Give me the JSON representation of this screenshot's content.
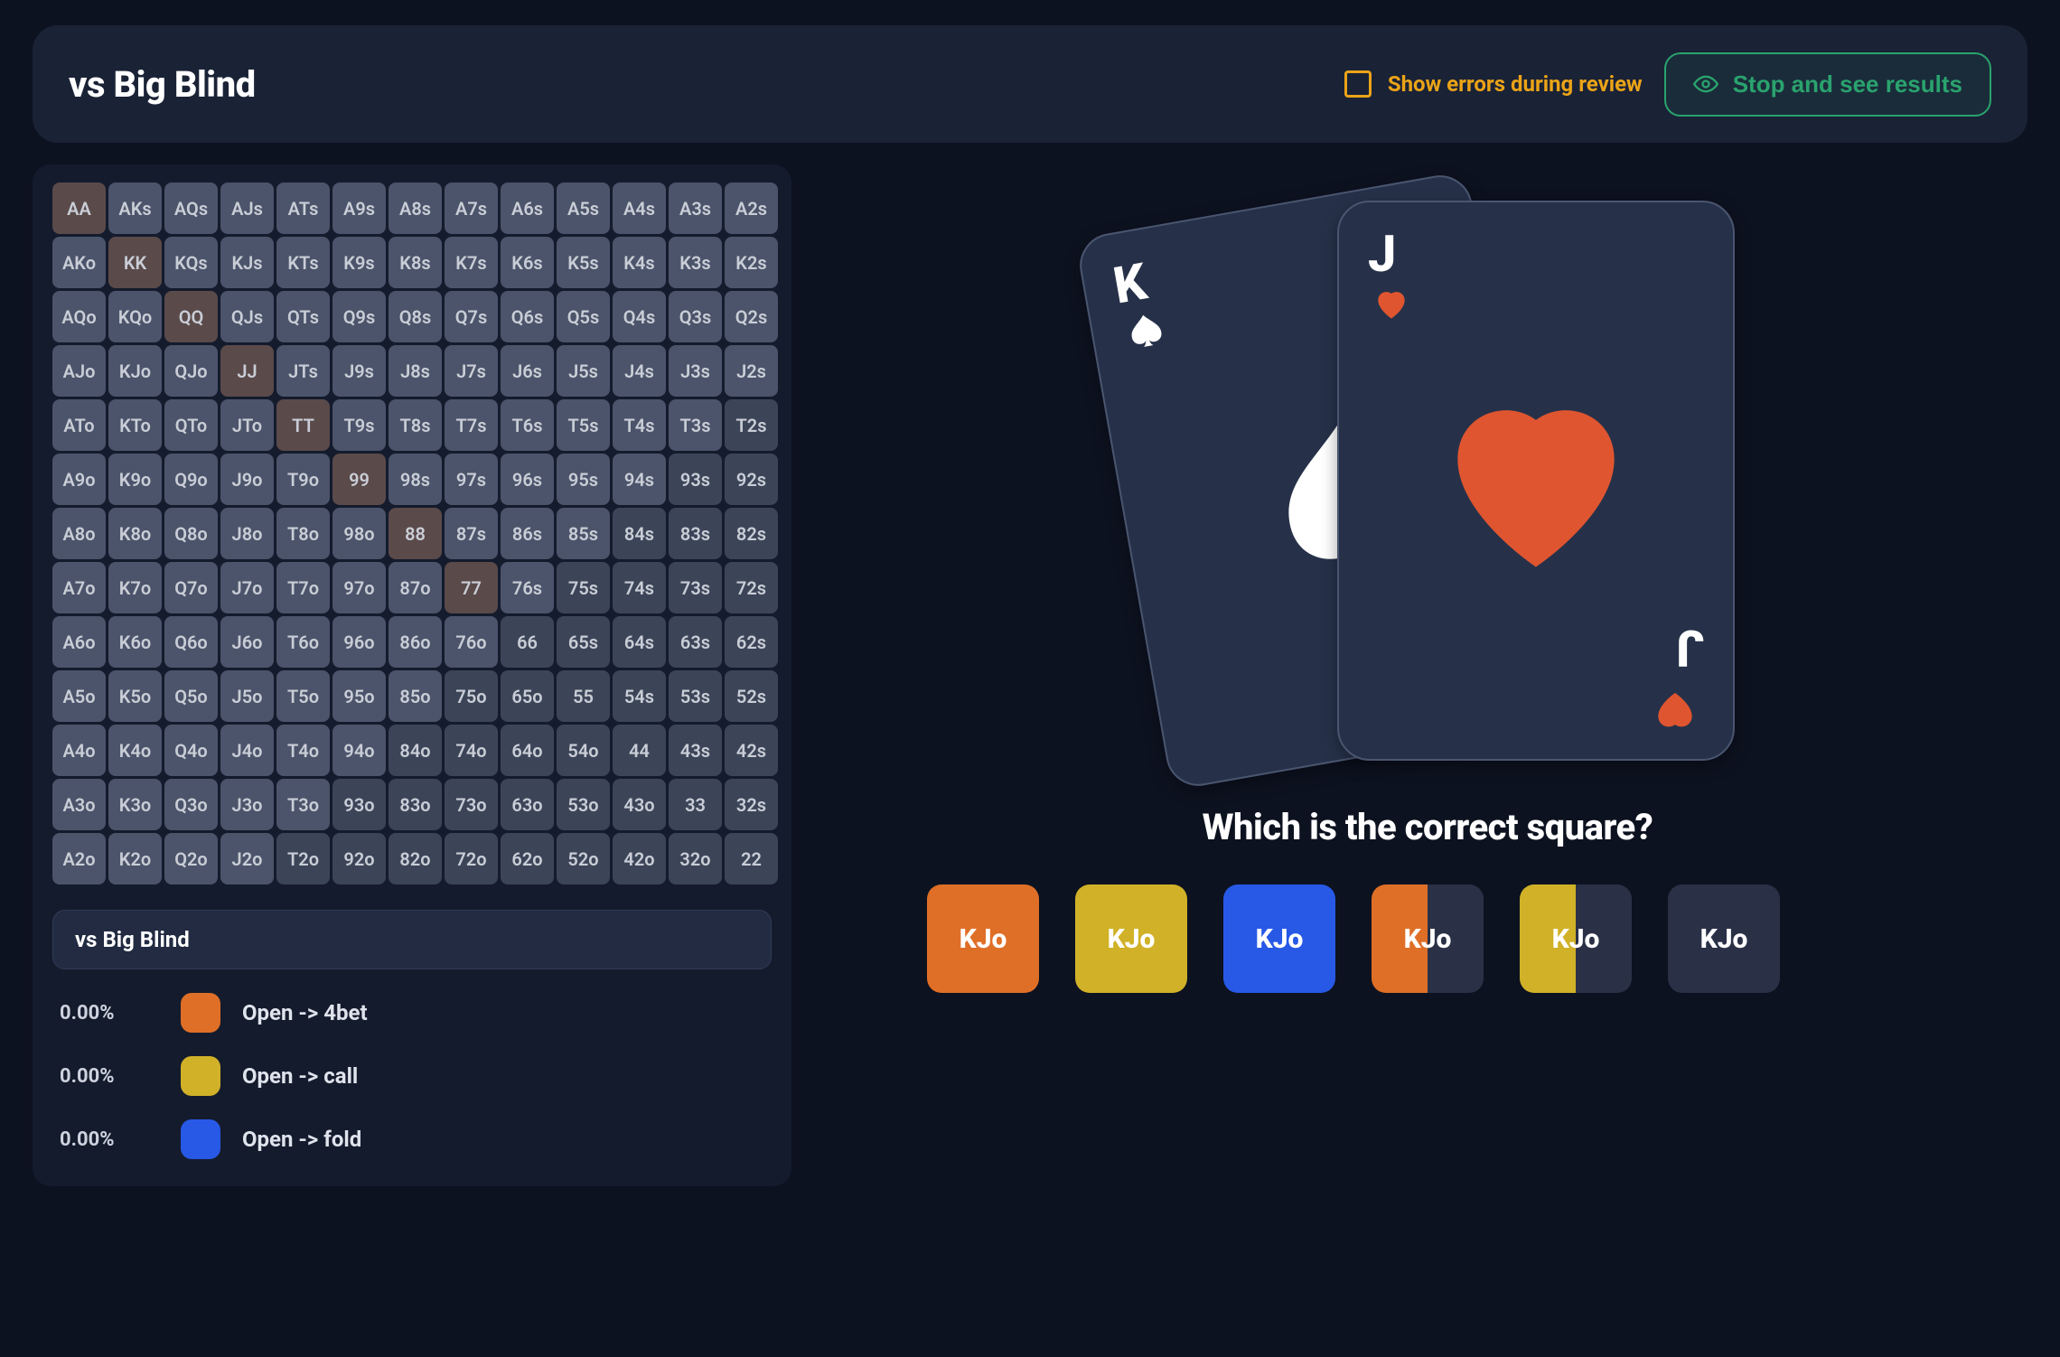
{
  "header": {
    "title": "vs Big Blind",
    "toggle_label": "Show errors during review",
    "results_label": "Stop and see results"
  },
  "range_panel": {
    "title": "vs Big Blind",
    "ranks": [
      "A",
      "K",
      "Q",
      "J",
      "T",
      "9",
      "8",
      "7",
      "6",
      "5",
      "4",
      "3",
      "2"
    ],
    "legend": [
      {
        "pct": "0.00%",
        "color": "orange",
        "label": "Open -> 4bet"
      },
      {
        "pct": "0.00%",
        "color": "yellow",
        "label": "Open -> call"
      },
      {
        "pct": "0.00%",
        "color": "blue",
        "label": "Open -> fold"
      }
    ]
  },
  "question_panel": {
    "cards": [
      {
        "rank": "K",
        "suit": "spade",
        "color": "white"
      },
      {
        "rank": "J",
        "suit": "heart",
        "color": "red"
      }
    ],
    "prompt": "Which is the correct square?",
    "hand_label": "KJo",
    "answers": [
      {
        "label": "KJo",
        "bg": "orange"
      },
      {
        "label": "KJo",
        "bg": "yellow"
      },
      {
        "label": "KJo",
        "bg": "blue"
      },
      {
        "label": "KJo",
        "split": [
          "orange",
          "dark"
        ]
      },
      {
        "label": "KJo",
        "split": [
          "yellow",
          "dark"
        ]
      },
      {
        "label": "KJo",
        "bg": "dark"
      }
    ]
  },
  "colors": {
    "orange": "#df6f27",
    "yellow": "#d0b127",
    "blue": "#2759e6",
    "dark": "#2a3147"
  }
}
